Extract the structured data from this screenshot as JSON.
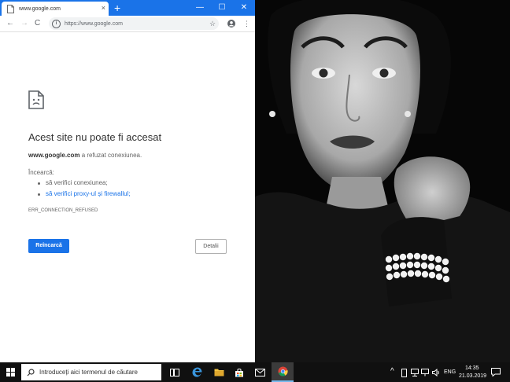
{
  "browser": {
    "tab_title": "www.google.com",
    "tab_close": "×",
    "new_tab": "+",
    "window_controls": {
      "minimize": "—",
      "maximize": "☐",
      "close": "✕"
    },
    "nav": {
      "back": "←",
      "forward": "→",
      "reload": "C"
    },
    "address": "https://www.google.com",
    "star": "☆",
    "menu": "⋮",
    "accent_color": "#1a73e8"
  },
  "error_page": {
    "heading": "Acest site nu poate fi accesat",
    "host": "www.google.com",
    "host_message": " a refuzat conexiunea.",
    "try_label": "Încearcă:",
    "suggestions": [
      "să verifici conexiunea;",
      "să verifici proxy-ul și firewallul;"
    ],
    "error_code": "ERR_CONNECTION_REFUSED",
    "reload_label": "Reîncarcă",
    "details_label": "Detalii"
  },
  "taskbar": {
    "search_placeholder": "Introduceți aici termenul de căutare",
    "language": "ENG",
    "time": "14:35",
    "date": "21.03.2019",
    "tray_up": "^"
  }
}
